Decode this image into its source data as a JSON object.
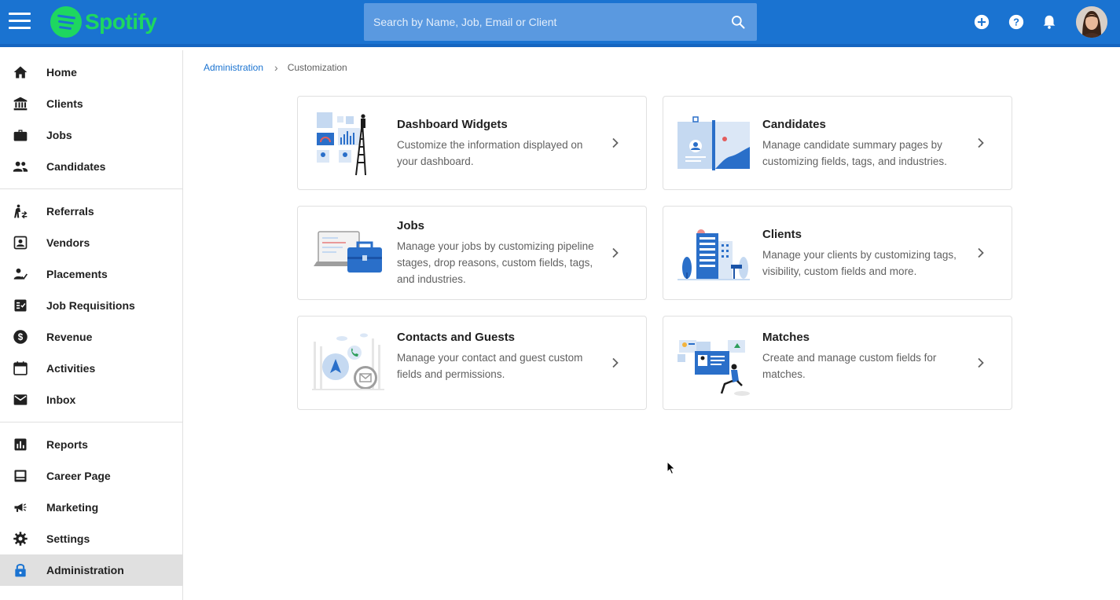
{
  "app": {
    "brand_name": "Spotify",
    "brand_color": "#1ed760",
    "accent_color": "#1a73d1"
  },
  "topbar": {
    "menu_icon": "hamburger-menu-icon",
    "search_placeholder": "Search by Name, Job, Email or Client",
    "search_icon": "search-icon",
    "add_icon": "add-circle-icon",
    "help_icon": "help-icon",
    "notifications_icon": "bell-icon",
    "avatar": "user-avatar"
  },
  "sidebar": {
    "groups": [
      [
        {
          "label": "Home",
          "icon": "home-icon"
        },
        {
          "label": "Clients",
          "icon": "bank-icon"
        },
        {
          "label": "Jobs",
          "icon": "briefcase-icon"
        },
        {
          "label": "Candidates",
          "icon": "people-icon"
        }
      ],
      [
        {
          "label": "Referrals",
          "icon": "referral-icon"
        },
        {
          "label": "Vendors",
          "icon": "vendor-icon"
        },
        {
          "label": "Placements",
          "icon": "placement-icon"
        },
        {
          "label": "Job Requisitions",
          "icon": "requisition-icon"
        },
        {
          "label": "Revenue",
          "icon": "dollar-icon"
        },
        {
          "label": "Activities",
          "icon": "calendar-icon"
        },
        {
          "label": "Inbox",
          "icon": "mail-icon"
        }
      ],
      [
        {
          "label": "Reports",
          "icon": "bar-chart-icon"
        },
        {
          "label": "Career Page",
          "icon": "career-page-icon"
        },
        {
          "label": "Marketing",
          "icon": "megaphone-icon"
        },
        {
          "label": "Settings",
          "icon": "gear-icon"
        },
        {
          "label": "Administration",
          "icon": "lock-icon",
          "active": true
        }
      ]
    ]
  },
  "breadcrumb": {
    "parent": "Administration",
    "separator": "›",
    "current": "Customization"
  },
  "cards": [
    {
      "title": "Dashboard Widgets",
      "description": "Customize the information displayed on your dashboard.",
      "illustration": "dashboard-widgets-illustration"
    },
    {
      "title": "Candidates",
      "description": "Manage candidate summary pages by customizing fields, tags, and industries.",
      "illustration": "candidates-illustration"
    },
    {
      "title": "Jobs",
      "description": "Manage your jobs by customizing pipeline stages, drop reasons, custom fields, tags, and industries.",
      "illustration": "jobs-illustration"
    },
    {
      "title": "Clients",
      "description": "Manage your clients by customizing tags, visibility, custom fields and more.",
      "illustration": "clients-illustration"
    },
    {
      "title": "Contacts and Guests",
      "description": "Manage your contact and guest custom fields and permissions.",
      "illustration": "contacts-illustration"
    },
    {
      "title": "Matches",
      "description": "Create and manage custom fields for matches.",
      "illustration": "matches-illustration"
    }
  ]
}
